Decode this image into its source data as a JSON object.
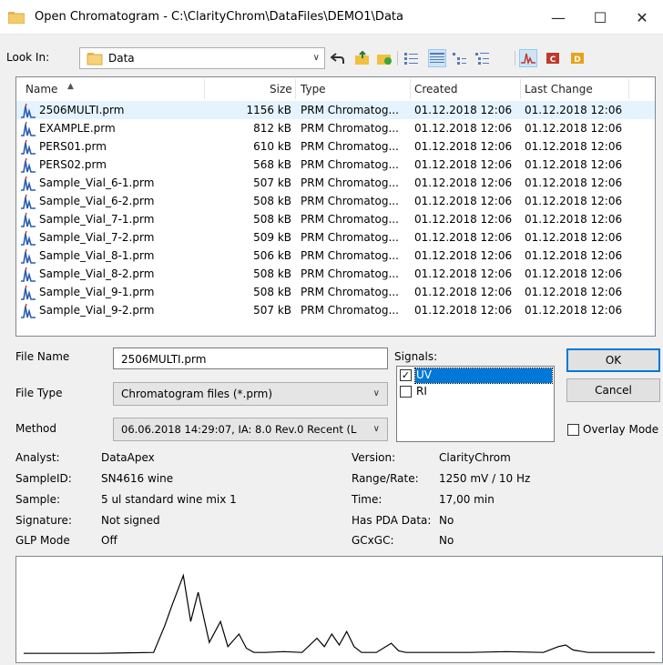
{
  "window": {
    "title": "Open Chromatogram - C:\\ClarityChrom\\DataFiles\\DEMO1\\Data",
    "minimize_label": "—",
    "maximize_label": "☐",
    "close_label": "✕"
  },
  "lookin": {
    "label": "Look In:",
    "value": "Data"
  },
  "toolbar_icons": [
    "back-icon",
    "up-folder-icon",
    "new-folder-icon",
    "list-view-icon",
    "details-view-icon",
    "tree-view-icon",
    "filter-icon",
    "chromatogram-type-icon",
    "calibration-type-icon",
    "data-type-icon"
  ],
  "columns": {
    "name": "Name",
    "size": "Size",
    "type": "Type",
    "created": "Created",
    "changed": "Last Change"
  },
  "files": [
    {
      "name": "2506MULTI.prm",
      "size": "1156 kB",
      "type": "PRM Chromatog...",
      "created": "01.12.2018 12:06",
      "changed": "01.12.2018 12:06"
    },
    {
      "name": "EXAMPLE.prm",
      "size": "812 kB",
      "type": "PRM Chromatog...",
      "created": "01.12.2018 12:06",
      "changed": "01.12.2018 12:06"
    },
    {
      "name": "PERS01.prm",
      "size": "610 kB",
      "type": "PRM Chromatog...",
      "created": "01.12.2018 12:06",
      "changed": "01.12.2018 12:06"
    },
    {
      "name": "PERS02.prm",
      "size": "568 kB",
      "type": "PRM Chromatog...",
      "created": "01.12.2018 12:06",
      "changed": "01.12.2018 12:06"
    },
    {
      "name": "Sample_Vial_6-1.prm",
      "size": "507 kB",
      "type": "PRM Chromatog...",
      "created": "01.12.2018 12:06",
      "changed": "01.12.2018 12:06"
    },
    {
      "name": "Sample_Vial_6-2.prm",
      "size": "508 kB",
      "type": "PRM Chromatog...",
      "created": "01.12.2018 12:06",
      "changed": "01.12.2018 12:06"
    },
    {
      "name": "Sample_Vial_7-1.prm",
      "size": "508 kB",
      "type": "PRM Chromatog...",
      "created": "01.12.2018 12:06",
      "changed": "01.12.2018 12:06"
    },
    {
      "name": "Sample_Vial_7-2.prm",
      "size": "509 kB",
      "type": "PRM Chromatog...",
      "created": "01.12.2018 12:06",
      "changed": "01.12.2018 12:06"
    },
    {
      "name": "Sample_Vial_8-1.prm",
      "size": "506 kB",
      "type": "PRM Chromatog...",
      "created": "01.12.2018 12:06",
      "changed": "01.12.2018 12:06"
    },
    {
      "name": "Sample_Vial_8-2.prm",
      "size": "508 kB",
      "type": "PRM Chromatog...",
      "created": "01.12.2018 12:06",
      "changed": "01.12.2018 12:06"
    },
    {
      "name": "Sample_Vial_9-1.prm",
      "size": "508 kB",
      "type": "PRM Chromatog...",
      "created": "01.12.2018 12:06",
      "changed": "01.12.2018 12:06"
    },
    {
      "name": "Sample_Vial_9-2.prm",
      "size": "507 kB",
      "type": "PRM Chromatog...",
      "created": "01.12.2018 12:06",
      "changed": "01.12.2018 12:06"
    }
  ],
  "form": {
    "filename_label": "File Name",
    "filename_value": "2506MULTI.prm",
    "filetype_label": "File Type",
    "filetype_value": "Chromatogram files (*.prm)",
    "method_label": "Method",
    "method_value": "06.06.2018 14:29:07, IA: 8.0 Rev.0 Recent (L",
    "signals_label": "Signals:",
    "signals": [
      {
        "label": "UV",
        "checked": true
      },
      {
        "label": "RI",
        "checked": false
      }
    ],
    "ok_label": "OK",
    "cancel_label": "Cancel",
    "overlay_label": "Overlay Mode"
  },
  "info": {
    "analyst_label": "Analyst:",
    "analyst": "DataApex",
    "sampleid_label": "SampleID:",
    "sampleid": "SN4616 wine",
    "sample_label": "Sample:",
    "sample": "5 ul standard wine mix 1",
    "signature_label": "Signature:",
    "signature": "Not signed",
    "glp_label": "GLP Mode",
    "glp": "Off",
    "version_label": "Version:",
    "version": "ClarityChrom",
    "range_label": "Range/Rate:",
    "range": "1250 mV / 10 Hz",
    "time_label": "Time:",
    "time": "17,00 min",
    "pda_label": "Has PDA Data:",
    "pda": "No",
    "gcxgc_label": "GCxGC:",
    "gcxgc": "No"
  },
  "chart_data": {
    "type": "line",
    "title": "",
    "xlabel": "",
    "ylabel": "",
    "x": [
      0.0,
      2.0,
      3.5,
      3.8,
      4.0,
      4.3,
      4.5,
      4.7,
      5.0,
      5.3,
      5.5,
      5.8,
      6.0,
      6.2,
      6.5,
      7.0,
      7.5,
      7.9,
      8.1,
      8.3,
      8.5,
      8.7,
      8.9,
      9.1,
      9.5,
      9.9,
      10.1,
      10.3,
      10.6,
      11.0,
      12.0,
      13.0,
      14.0,
      14.4,
      14.6,
      14.8,
      15.2,
      15.6,
      16.0,
      17.0
    ],
    "y": [
      2,
      2,
      3,
      35,
      60,
      95,
      40,
      75,
      15,
      40,
      10,
      25,
      8,
      3,
      3,
      4,
      3,
      20,
      10,
      25,
      12,
      28,
      10,
      3,
      3,
      14,
      5,
      3,
      3,
      3,
      3,
      4,
      3,
      10,
      12,
      6,
      3,
      3,
      3,
      3
    ],
    "xlim": [
      0,
      17
    ],
    "ylim": [
      0,
      100
    ],
    "grid": false
  }
}
